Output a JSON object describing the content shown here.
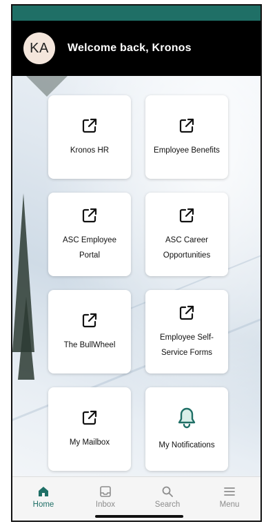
{
  "header": {
    "avatar_initials": "KA",
    "welcome_text": "Welcome back, Kronos"
  },
  "colors": {
    "accent": "#1f6f66",
    "status_bar": "#1f6f66",
    "header_bg": "#000000",
    "tile_bg": "#ffffff"
  },
  "tiles": [
    {
      "label": "Kronos HR",
      "icon": "external-link-icon"
    },
    {
      "label": "Employee Benefits",
      "icon": "external-link-icon"
    },
    {
      "label": "ASC Employee Portal",
      "icon": "external-link-icon"
    },
    {
      "label": "ASC Career Opportunities",
      "icon": "external-link-icon"
    },
    {
      "label": "The BullWheel",
      "icon": "external-link-icon"
    },
    {
      "label": "Employee Self-Service Forms",
      "icon": "external-link-icon"
    },
    {
      "label": "My Mailbox",
      "icon": "external-link-icon"
    },
    {
      "label": "My Notifications",
      "icon": "bell-icon"
    }
  ],
  "tabbar": {
    "items": [
      {
        "label": "Home",
        "icon": "home-icon",
        "active": true
      },
      {
        "label": "Inbox",
        "icon": "inbox-icon",
        "active": false
      },
      {
        "label": "Search",
        "icon": "search-icon",
        "active": false
      },
      {
        "label": "Menu",
        "icon": "menu-icon",
        "active": false
      }
    ]
  }
}
